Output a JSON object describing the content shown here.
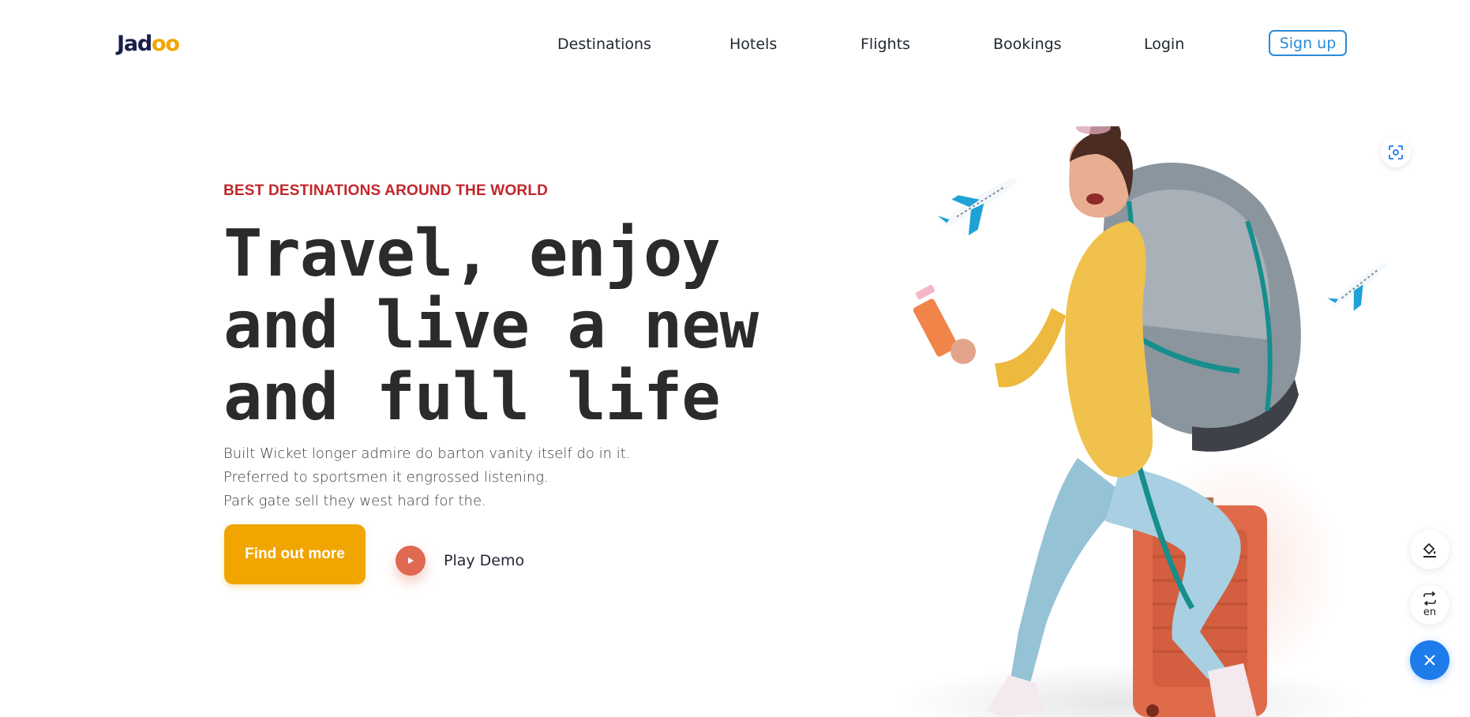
{
  "brand": {
    "logo_prefix": "Jad",
    "logo_suffix": "oo"
  },
  "nav": {
    "items": [
      {
        "label": "Destinations"
      },
      {
        "label": "Hotels"
      },
      {
        "label": "Flights"
      },
      {
        "label": "Bookings"
      },
      {
        "label": "Login"
      }
    ],
    "signup_label": "Sign up"
  },
  "hero": {
    "eyebrow": "BEST DESTINATIONS AROUND THE WORLD",
    "headline_lines": [
      "Travel, enjoy",
      "and live a new",
      "and full life"
    ],
    "description_lines": [
      "Built Wicket longer admire do barton vanity itself do in it.",
      "Preferred to sportsmen it engrossed listening.",
      "Park gate sell they west hard for the."
    ],
    "cta_label": "Find out more",
    "play_label": "Play Demo"
  },
  "widgets": {
    "language_code": "en"
  },
  "colors": {
    "accent_yellow": "#F1A501",
    "eyebrow_red": "#C0262B",
    "play_orange": "#DF6951",
    "signup_blue": "#2A8AD8",
    "close_blue": "#1E7BEA"
  },
  "icons": {
    "focus": "focus-scan-icon",
    "paint": "paint-bucket-icon",
    "translate": "repeat-arrows-icon",
    "close": "close-icon",
    "play": "play-icon"
  }
}
